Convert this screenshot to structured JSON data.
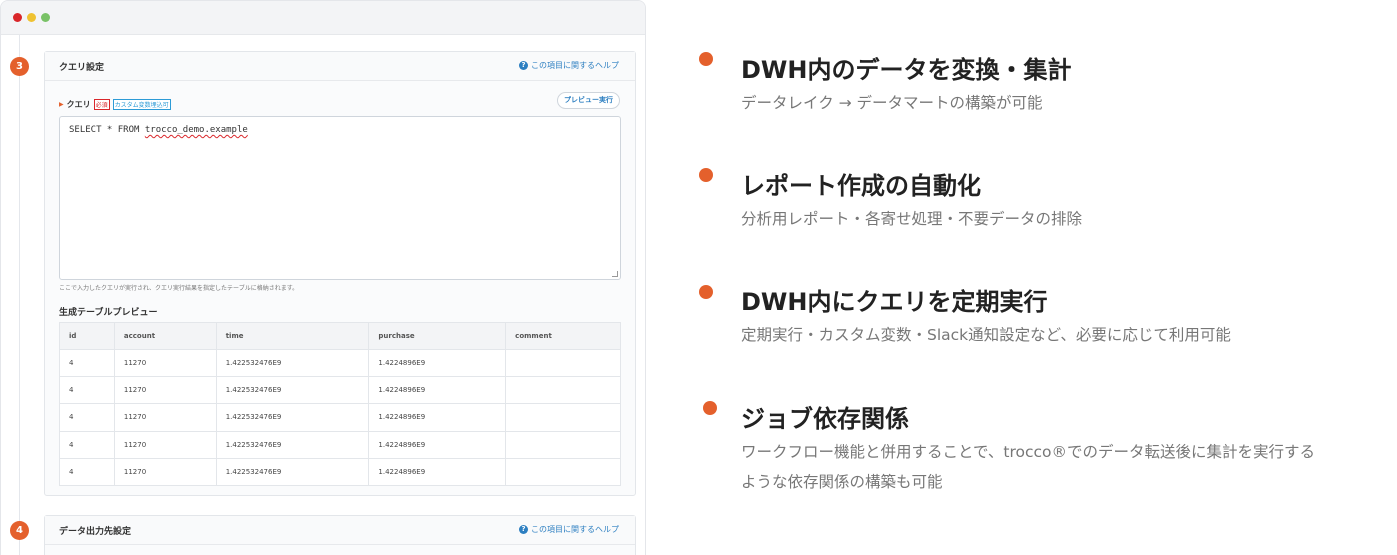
{
  "screenshot": {
    "step3": {
      "number": "3",
      "title": "クエリ設定",
      "help_link": "この項目に関するヘルプ",
      "query_label": "クエリ",
      "badge_required": "必須",
      "badge_custom_var": "カスタム変数埋込可",
      "preview_button": "プレビュー実行",
      "query_text_prefix": "SELECT * FROM ",
      "query_text_table": "trocco_demo.example",
      "hint": "ここで入力したクエリが実行され、クエリ実行結果を指定したテーブルに格納されます。",
      "table_title": "生成テーブルプレビュー",
      "columns": [
        "id",
        "account",
        "time",
        "purchase",
        "comment"
      ],
      "rows": [
        [
          "4",
          "11270",
          "1.422532476E9",
          "1.4224896E9",
          ""
        ],
        [
          "4",
          "11270",
          "1.422532476E9",
          "1.4224896E9",
          ""
        ],
        [
          "4",
          "11270",
          "1.422532476E9",
          "1.4224896E9",
          ""
        ],
        [
          "4",
          "11270",
          "1.422532476E9",
          "1.4224896E9",
          ""
        ],
        [
          "4",
          "11270",
          "1.422532476E9",
          "1.4224896E9",
          ""
        ]
      ]
    },
    "step4": {
      "number": "4",
      "title": "データ出力先設定",
      "help_link": "この項目に関するヘルプ"
    }
  },
  "features": [
    {
      "title": "DWH内のデータを変換・集計",
      "desc": [
        "データレイク → データマートの構築が可能"
      ]
    },
    {
      "title": "レポート作成の自動化",
      "desc": [
        "分析用レポート・各寄せ処理・不要データの排除"
      ]
    },
    {
      "title": "DWH内にクエリを定期実行",
      "desc": [
        "定期実行・カスタム変数・Slack通知設定など、必要に応じて利用可能"
      ]
    },
    {
      "title": "ジョブ依存関係",
      "desc": [
        "ワークフロー機能と併用することで、trocco®でのデータ転送後に集計を実行する",
        "ような依存関係の構築も可能"
      ]
    }
  ],
  "colors": {
    "accent": "#e4602c",
    "link": "#2d7fc1",
    "required": "#d9262a"
  }
}
